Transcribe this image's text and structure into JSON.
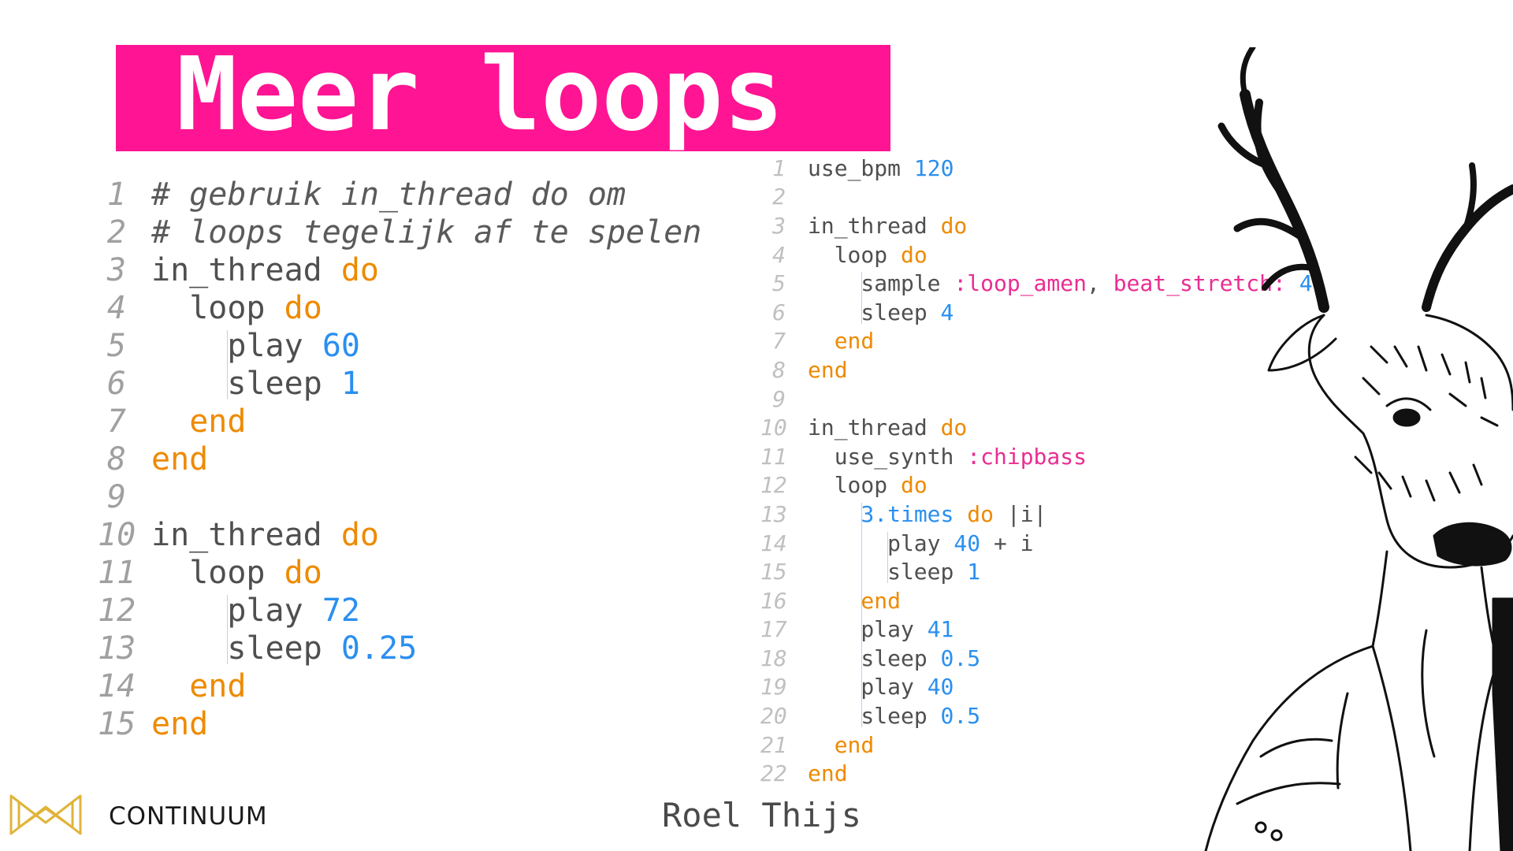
{
  "slide": {
    "title": "Meer loops",
    "accent_color": "#ff1493",
    "author": "Roel Thijs",
    "brand": "CONTINUUM",
    "brand_icon": "continuum-logo-icon",
    "illustration": "deer-in-suit-illustration"
  },
  "code_left": {
    "lines": [
      {
        "n": "1",
        "indent": 0,
        "tokens": [
          {
            "t": "# gebruik in_thread do om",
            "c": "com"
          }
        ]
      },
      {
        "n": "2",
        "indent": 0,
        "tokens": [
          {
            "t": "# loops tegelijk af te spelen",
            "c": "com"
          }
        ]
      },
      {
        "n": "3",
        "indent": 0,
        "tokens": [
          {
            "t": "in_thread ",
            "c": "plain"
          },
          {
            "t": "do",
            "c": "kw"
          }
        ]
      },
      {
        "n": "4",
        "indent": 1,
        "tokens": [
          {
            "t": "loop ",
            "c": "plain"
          },
          {
            "t": "do",
            "c": "kw"
          }
        ]
      },
      {
        "n": "5",
        "indent": 2,
        "tokens": [
          {
            "t": "play ",
            "c": "plain"
          },
          {
            "t": "60",
            "c": "num"
          }
        ]
      },
      {
        "n": "6",
        "indent": 2,
        "tokens": [
          {
            "t": "sleep ",
            "c": "plain"
          },
          {
            "t": "1",
            "c": "num"
          }
        ]
      },
      {
        "n": "7",
        "indent": 1,
        "tokens": [
          {
            "t": "end",
            "c": "kw"
          }
        ]
      },
      {
        "n": "8",
        "indent": 0,
        "tokens": [
          {
            "t": "end",
            "c": "kw"
          }
        ]
      },
      {
        "n": "9",
        "indent": 0,
        "tokens": []
      },
      {
        "n": "10",
        "indent": 0,
        "tokens": [
          {
            "t": "in_thread ",
            "c": "plain"
          },
          {
            "t": "do",
            "c": "kw"
          }
        ]
      },
      {
        "n": "11",
        "indent": 1,
        "tokens": [
          {
            "t": "loop ",
            "c": "plain"
          },
          {
            "t": "do",
            "c": "kw"
          }
        ]
      },
      {
        "n": "12",
        "indent": 2,
        "tokens": [
          {
            "t": "play ",
            "c": "plain"
          },
          {
            "t": "72",
            "c": "num"
          }
        ]
      },
      {
        "n": "13",
        "indent": 2,
        "tokens": [
          {
            "t": "sleep ",
            "c": "plain"
          },
          {
            "t": "0.25",
            "c": "num"
          }
        ]
      },
      {
        "n": "14",
        "indent": 1,
        "tokens": [
          {
            "t": "end",
            "c": "kw"
          }
        ]
      },
      {
        "n": "15",
        "indent": 0,
        "tokens": [
          {
            "t": "end",
            "c": "kw"
          }
        ]
      }
    ]
  },
  "code_right": {
    "lines": [
      {
        "n": "1",
        "indent": 0,
        "tokens": [
          {
            "t": "use_bpm ",
            "c": "plain"
          },
          {
            "t": "120",
            "c": "num"
          }
        ]
      },
      {
        "n": "2",
        "indent": 0,
        "tokens": []
      },
      {
        "n": "3",
        "indent": 0,
        "tokens": [
          {
            "t": "in_thread ",
            "c": "plain"
          },
          {
            "t": "do",
            "c": "kw"
          }
        ]
      },
      {
        "n": "4",
        "indent": 1,
        "tokens": [
          {
            "t": "loop ",
            "c": "plain"
          },
          {
            "t": "do",
            "c": "kw"
          }
        ]
      },
      {
        "n": "5",
        "indent": 2,
        "tokens": [
          {
            "t": "sample ",
            "c": "plain"
          },
          {
            "t": ":loop_amen",
            "c": "sym"
          },
          {
            "t": ", ",
            "c": "plain"
          },
          {
            "t": "beat_stretch:",
            "c": "sym"
          },
          {
            "t": " ",
            "c": "plain"
          },
          {
            "t": "4",
            "c": "num"
          }
        ]
      },
      {
        "n": "6",
        "indent": 2,
        "tokens": [
          {
            "t": "sleep ",
            "c": "plain"
          },
          {
            "t": "4",
            "c": "num"
          }
        ]
      },
      {
        "n": "7",
        "indent": 1,
        "tokens": [
          {
            "t": "end",
            "c": "kw"
          }
        ]
      },
      {
        "n": "8",
        "indent": 0,
        "tokens": [
          {
            "t": "end",
            "c": "kw"
          }
        ]
      },
      {
        "n": "9",
        "indent": 0,
        "tokens": []
      },
      {
        "n": "10",
        "indent": 0,
        "tokens": [
          {
            "t": "in_thread ",
            "c": "plain"
          },
          {
            "t": "do",
            "c": "kw"
          }
        ]
      },
      {
        "n": "11",
        "indent": 1,
        "tokens": [
          {
            "t": "use_synth ",
            "c": "plain"
          },
          {
            "t": ":chipbass",
            "c": "sym"
          }
        ]
      },
      {
        "n": "12",
        "indent": 1,
        "tokens": [
          {
            "t": "loop ",
            "c": "plain"
          },
          {
            "t": "do",
            "c": "kw"
          }
        ]
      },
      {
        "n": "13",
        "indent": 2,
        "tokens": [
          {
            "t": "3.times",
            "c": "num"
          },
          {
            "t": " ",
            "c": "plain"
          },
          {
            "t": "do",
            "c": "kw"
          },
          {
            "t": " |i|",
            "c": "plain"
          }
        ]
      },
      {
        "n": "14",
        "indent": 3,
        "tokens": [
          {
            "t": "play ",
            "c": "plain"
          },
          {
            "t": "40",
            "c": "num"
          },
          {
            "t": " + i",
            "c": "plain"
          }
        ]
      },
      {
        "n": "15",
        "indent": 3,
        "tokens": [
          {
            "t": "sleep ",
            "c": "plain"
          },
          {
            "t": "1",
            "c": "num"
          }
        ]
      },
      {
        "n": "16",
        "indent": 2,
        "tokens": [
          {
            "t": "end",
            "c": "kw"
          }
        ]
      },
      {
        "n": "17",
        "indent": 2,
        "tokens": [
          {
            "t": "play ",
            "c": "plain"
          },
          {
            "t": "41",
            "c": "num"
          }
        ]
      },
      {
        "n": "18",
        "indent": 2,
        "tokens": [
          {
            "t": "sleep ",
            "c": "plain"
          },
          {
            "t": "0.5",
            "c": "num"
          }
        ]
      },
      {
        "n": "19",
        "indent": 2,
        "tokens": [
          {
            "t": "play ",
            "c": "plain"
          },
          {
            "t": "40",
            "c": "num"
          }
        ]
      },
      {
        "n": "20",
        "indent": 2,
        "tokens": [
          {
            "t": "sleep ",
            "c": "plain"
          },
          {
            "t": "0.5",
            "c": "num"
          }
        ]
      },
      {
        "n": "21",
        "indent": 1,
        "tokens": [
          {
            "t": "end",
            "c": "kw"
          }
        ]
      },
      {
        "n": "22",
        "indent": 0,
        "tokens": [
          {
            "t": "end",
            "c": "kw"
          }
        ]
      }
    ]
  }
}
